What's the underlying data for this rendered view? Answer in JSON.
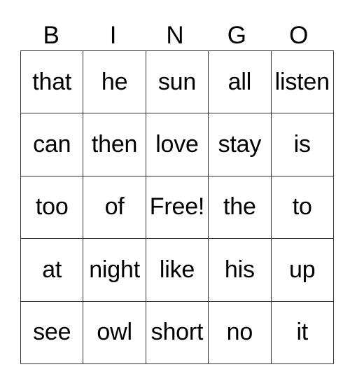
{
  "header": {
    "letters": [
      "B",
      "I",
      "N",
      "G",
      "O"
    ]
  },
  "board": {
    "rows": [
      [
        "that",
        "he",
        "sun",
        "all",
        "listen"
      ],
      [
        "can",
        "then",
        "love",
        "stay",
        "is"
      ],
      [
        "too",
        "of",
        "Free!",
        "the",
        "to"
      ],
      [
        "at",
        "night",
        "like",
        "his",
        "up"
      ],
      [
        "see",
        "owl",
        "short",
        "no",
        "it"
      ]
    ]
  }
}
